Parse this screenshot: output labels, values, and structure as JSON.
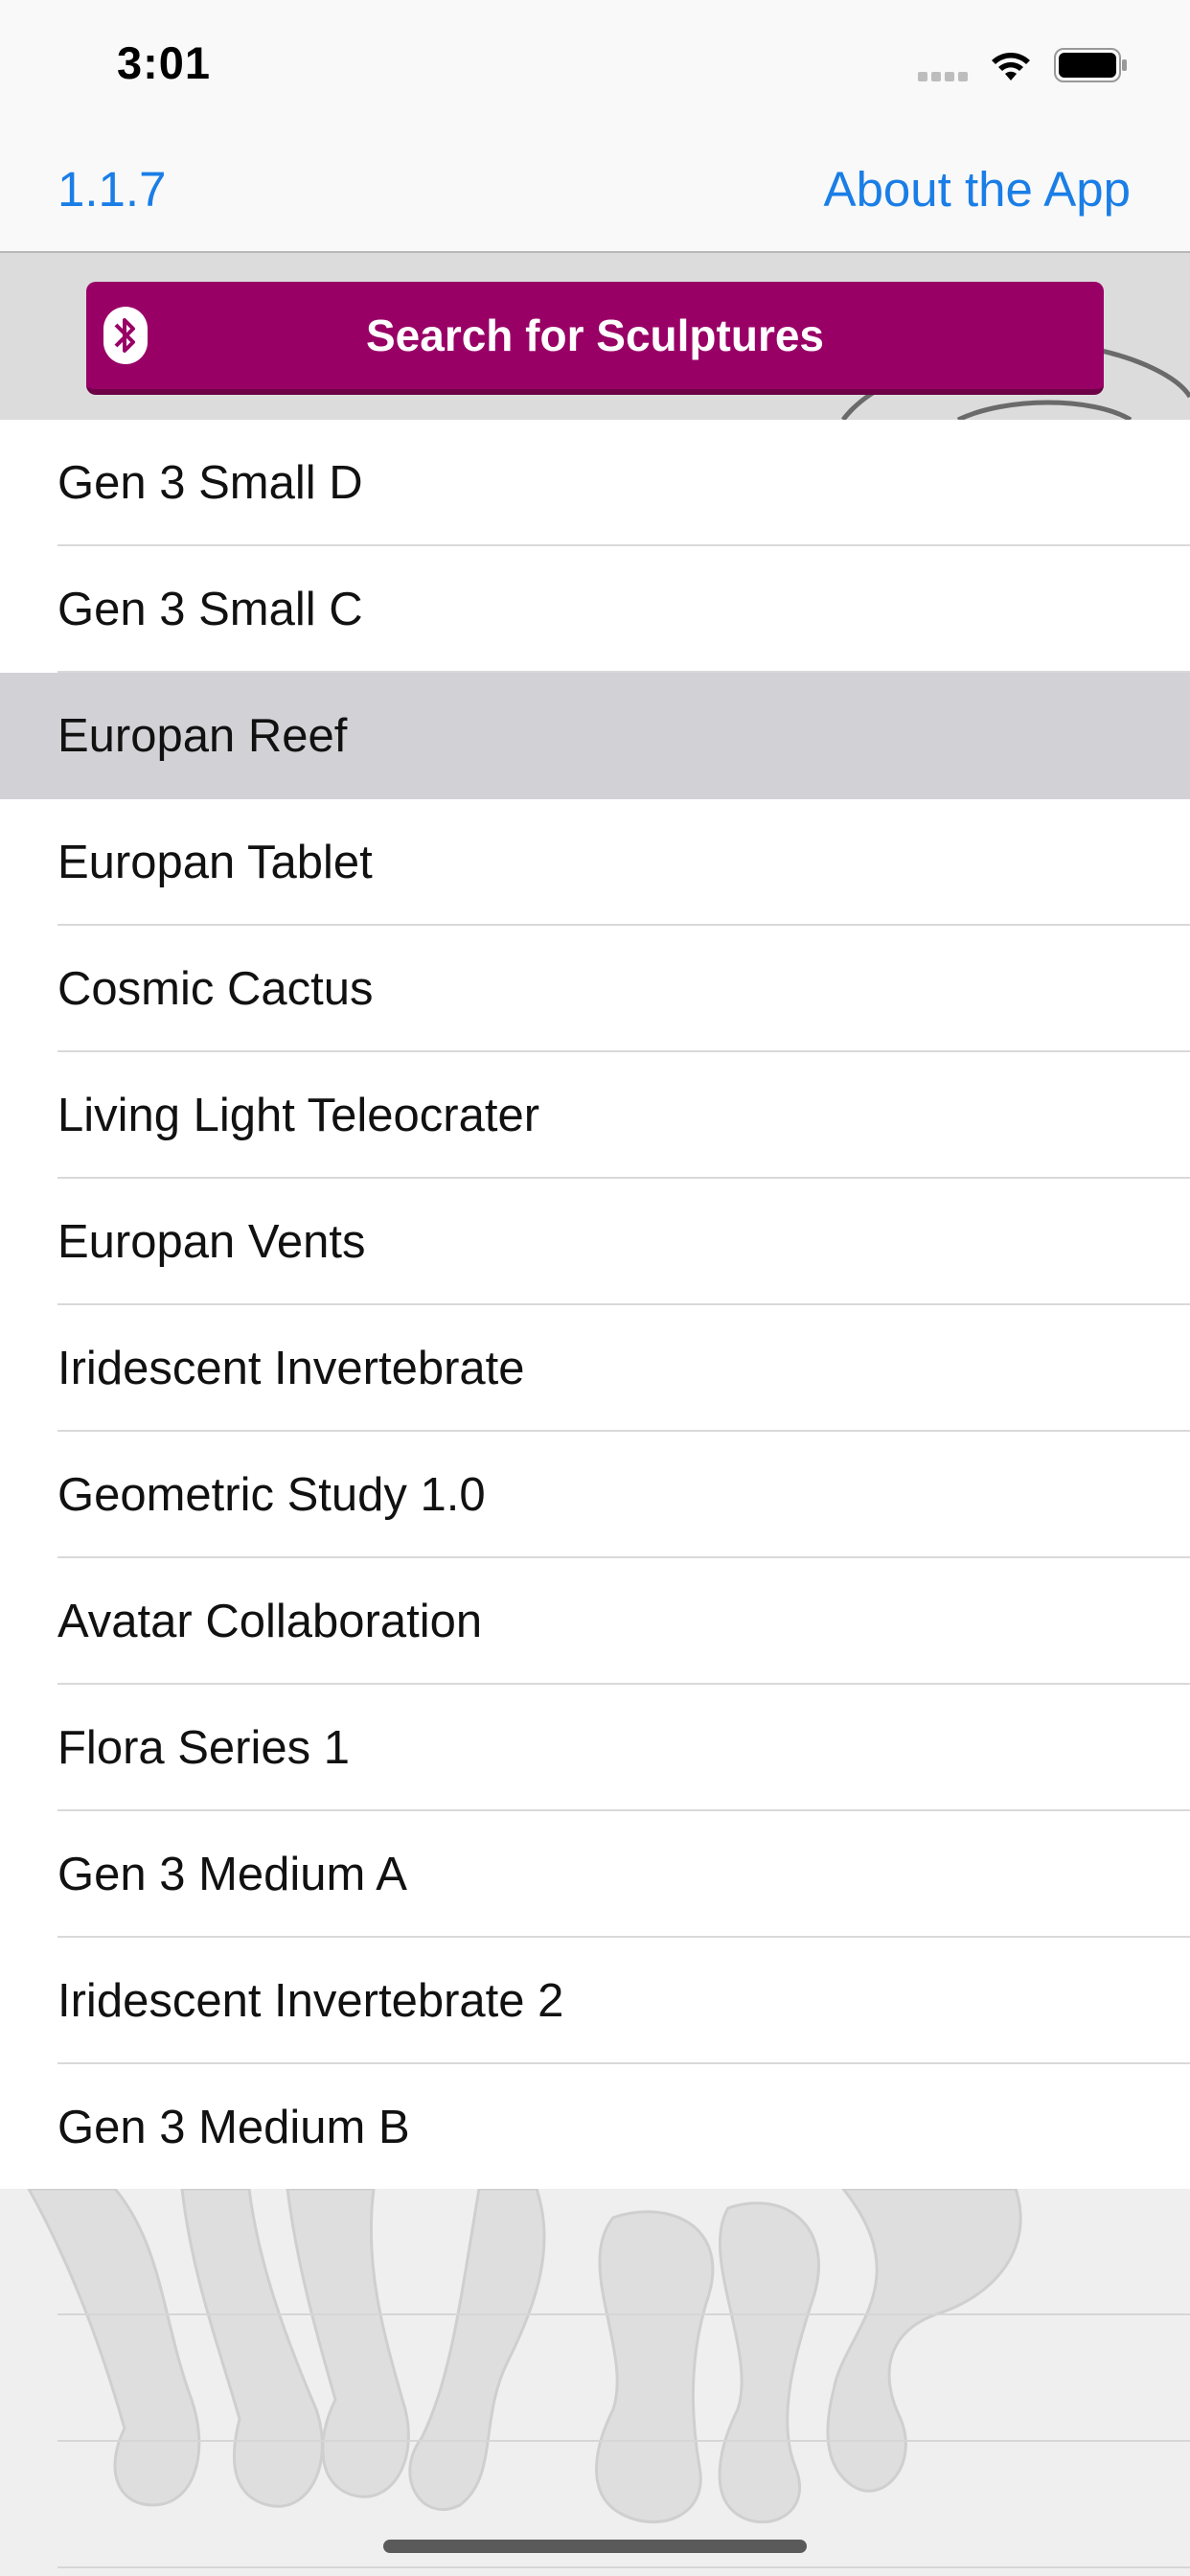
{
  "status_bar": {
    "time": "3:01",
    "icons": [
      "signal-icon",
      "wifi-icon",
      "battery-icon"
    ]
  },
  "nav": {
    "version": "1.1.7",
    "about": "About the App"
  },
  "header": {
    "search_button": "Search for Sculptures",
    "icon": "bluetooth-icon",
    "button_color": "#990066"
  },
  "list": {
    "selected_index": 2,
    "items": [
      {
        "label": "Gen 3 Small D"
      },
      {
        "label": "Gen 3 Small C"
      },
      {
        "label": "Europan Reef"
      },
      {
        "label": "Europan Tablet"
      },
      {
        "label": "Cosmic Cactus"
      },
      {
        "label": "Living Light Teleocrater"
      },
      {
        "label": "Europan Vents"
      },
      {
        "label": "Iridescent Invertebrate"
      },
      {
        "label": "Geometric Study 1.0"
      },
      {
        "label": "Avatar Collaboration"
      },
      {
        "label": "Flora Series 1"
      },
      {
        "label": "Gen 3 Medium A"
      },
      {
        "label": "Iridescent Invertebrate 2"
      },
      {
        "label": "Gen 3 Medium B"
      }
    ]
  },
  "colors": {
    "link": "#1a7ee6",
    "selected_row": "#d1d1d6"
  }
}
